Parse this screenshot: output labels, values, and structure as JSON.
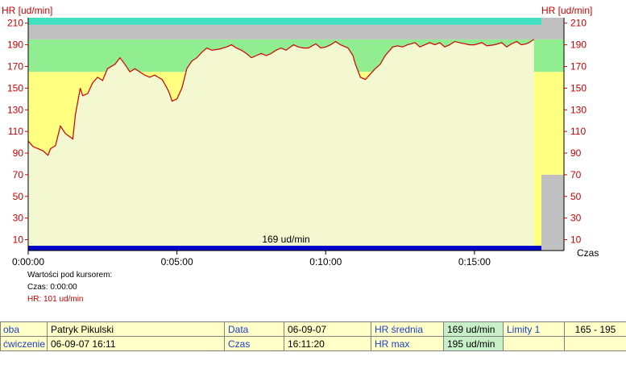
{
  "chart_data": {
    "type": "area",
    "y_axis_label_left": "HR [ud/min]",
    "y_axis_label_right": "HR [ud/min]",
    "x_axis_label": "Czas",
    "ylim": [
      0,
      215
    ],
    "xlim_seconds": [
      0,
      1035
    ],
    "y_ticks": [
      10,
      30,
      50,
      70,
      90,
      110,
      130,
      150,
      170,
      190,
      210
    ],
    "x_tick_labels": [
      "0:00:00",
      "0:05:00",
      "0:10:00",
      "0:15:00"
    ],
    "zones": [
      {
        "name": "limit-band",
        "from": 165,
        "to": 195,
        "color": "#90ee90"
      },
      {
        "name": "above-limit",
        "from": 195,
        "to": 215,
        "color": "#c0c0c0"
      },
      {
        "name": "below-limit",
        "from": 0,
        "to": 165,
        "color": "#ffff80"
      }
    ],
    "colors": {
      "plot_bg": "#f3f8d0",
      "line": "#cc0000",
      "axis_text": "#cc0000",
      "band": "#0000c8",
      "end_gray": "#c0c0c0",
      "right_green": "#90ee90",
      "right_yellow": "#ffff80",
      "cyan_top": "#40e0c0"
    },
    "band_label": "169 ud/min",
    "series": [
      {
        "x": [
          0,
          10,
          20,
          30,
          40,
          45,
          55,
          65,
          75,
          90,
          95,
          105,
          110,
          120,
          130,
          140,
          150,
          160,
          175,
          185,
          195,
          205,
          215,
          225,
          235,
          245,
          255,
          262,
          270,
          280,
          285,
          290,
          300,
          310,
          320,
          330,
          340,
          350,
          360,
          370,
          385,
          400,
          410,
          420,
          430,
          440,
          450,
          460,
          470,
          480,
          490,
          500,
          510,
          520,
          535,
          545,
          555,
          565,
          580,
          590,
          600,
          610,
          620,
          630,
          645,
          655,
          660,
          670,
          680,
          700,
          710,
          720,
          735,
          745,
          755,
          765,
          780,
          790,
          800,
          810,
          820,
          830,
          840,
          850,
          860,
          870,
          880,
          890,
          900,
          915,
          925,
          940,
          955,
          965,
          975,
          985,
          995,
          1005,
          1010,
          1020
        ],
        "y": [
          101,
          96,
          94,
          92,
          88,
          94,
          97,
          115,
          108,
          103,
          125,
          150,
          143,
          145,
          155,
          160,
          157,
          168,
          172,
          178,
          172,
          165,
          168,
          165,
          162,
          160,
          162,
          160,
          158,
          150,
          145,
          138,
          140,
          150,
          168,
          175,
          178,
          183,
          187,
          185,
          186,
          188,
          190,
          187,
          185,
          182,
          178,
          180,
          182,
          180,
          182,
          185,
          187,
          185,
          190,
          188,
          187,
          187,
          191,
          187,
          188,
          190,
          193,
          190,
          187,
          180,
          172,
          160,
          158,
          168,
          172,
          180,
          188,
          189,
          188,
          190,
          192,
          188,
          190,
          192,
          190,
          192,
          188,
          190,
          193,
          192,
          191,
          190,
          190,
          192,
          189,
          190,
          192,
          188,
          191,
          193,
          190,
          191,
          192,
          195
        ]
      }
    ]
  },
  "cursor_info": {
    "title": "Wartości pod kursorem:",
    "time": "Czas: 0:00:00",
    "hr": "HR: 101 ud/min"
  },
  "stats": {
    "row1": {
      "l1": "oba",
      "v1": "Patryk Pikulski",
      "l2": "Data",
      "v2": "06-09-07",
      "l3": "HR średnia",
      "v3": "169 ud/min",
      "l4": "Limity 1",
      "v4": "165 - 195"
    },
    "row2": {
      "l1": "ćwiczenie",
      "v1": "06-09-07 16:11",
      "l2": "Czas",
      "v2": "16:11:20",
      "l3": "HR max",
      "v3": "195 ud/min",
      "l4": "",
      "v4": ""
    }
  }
}
